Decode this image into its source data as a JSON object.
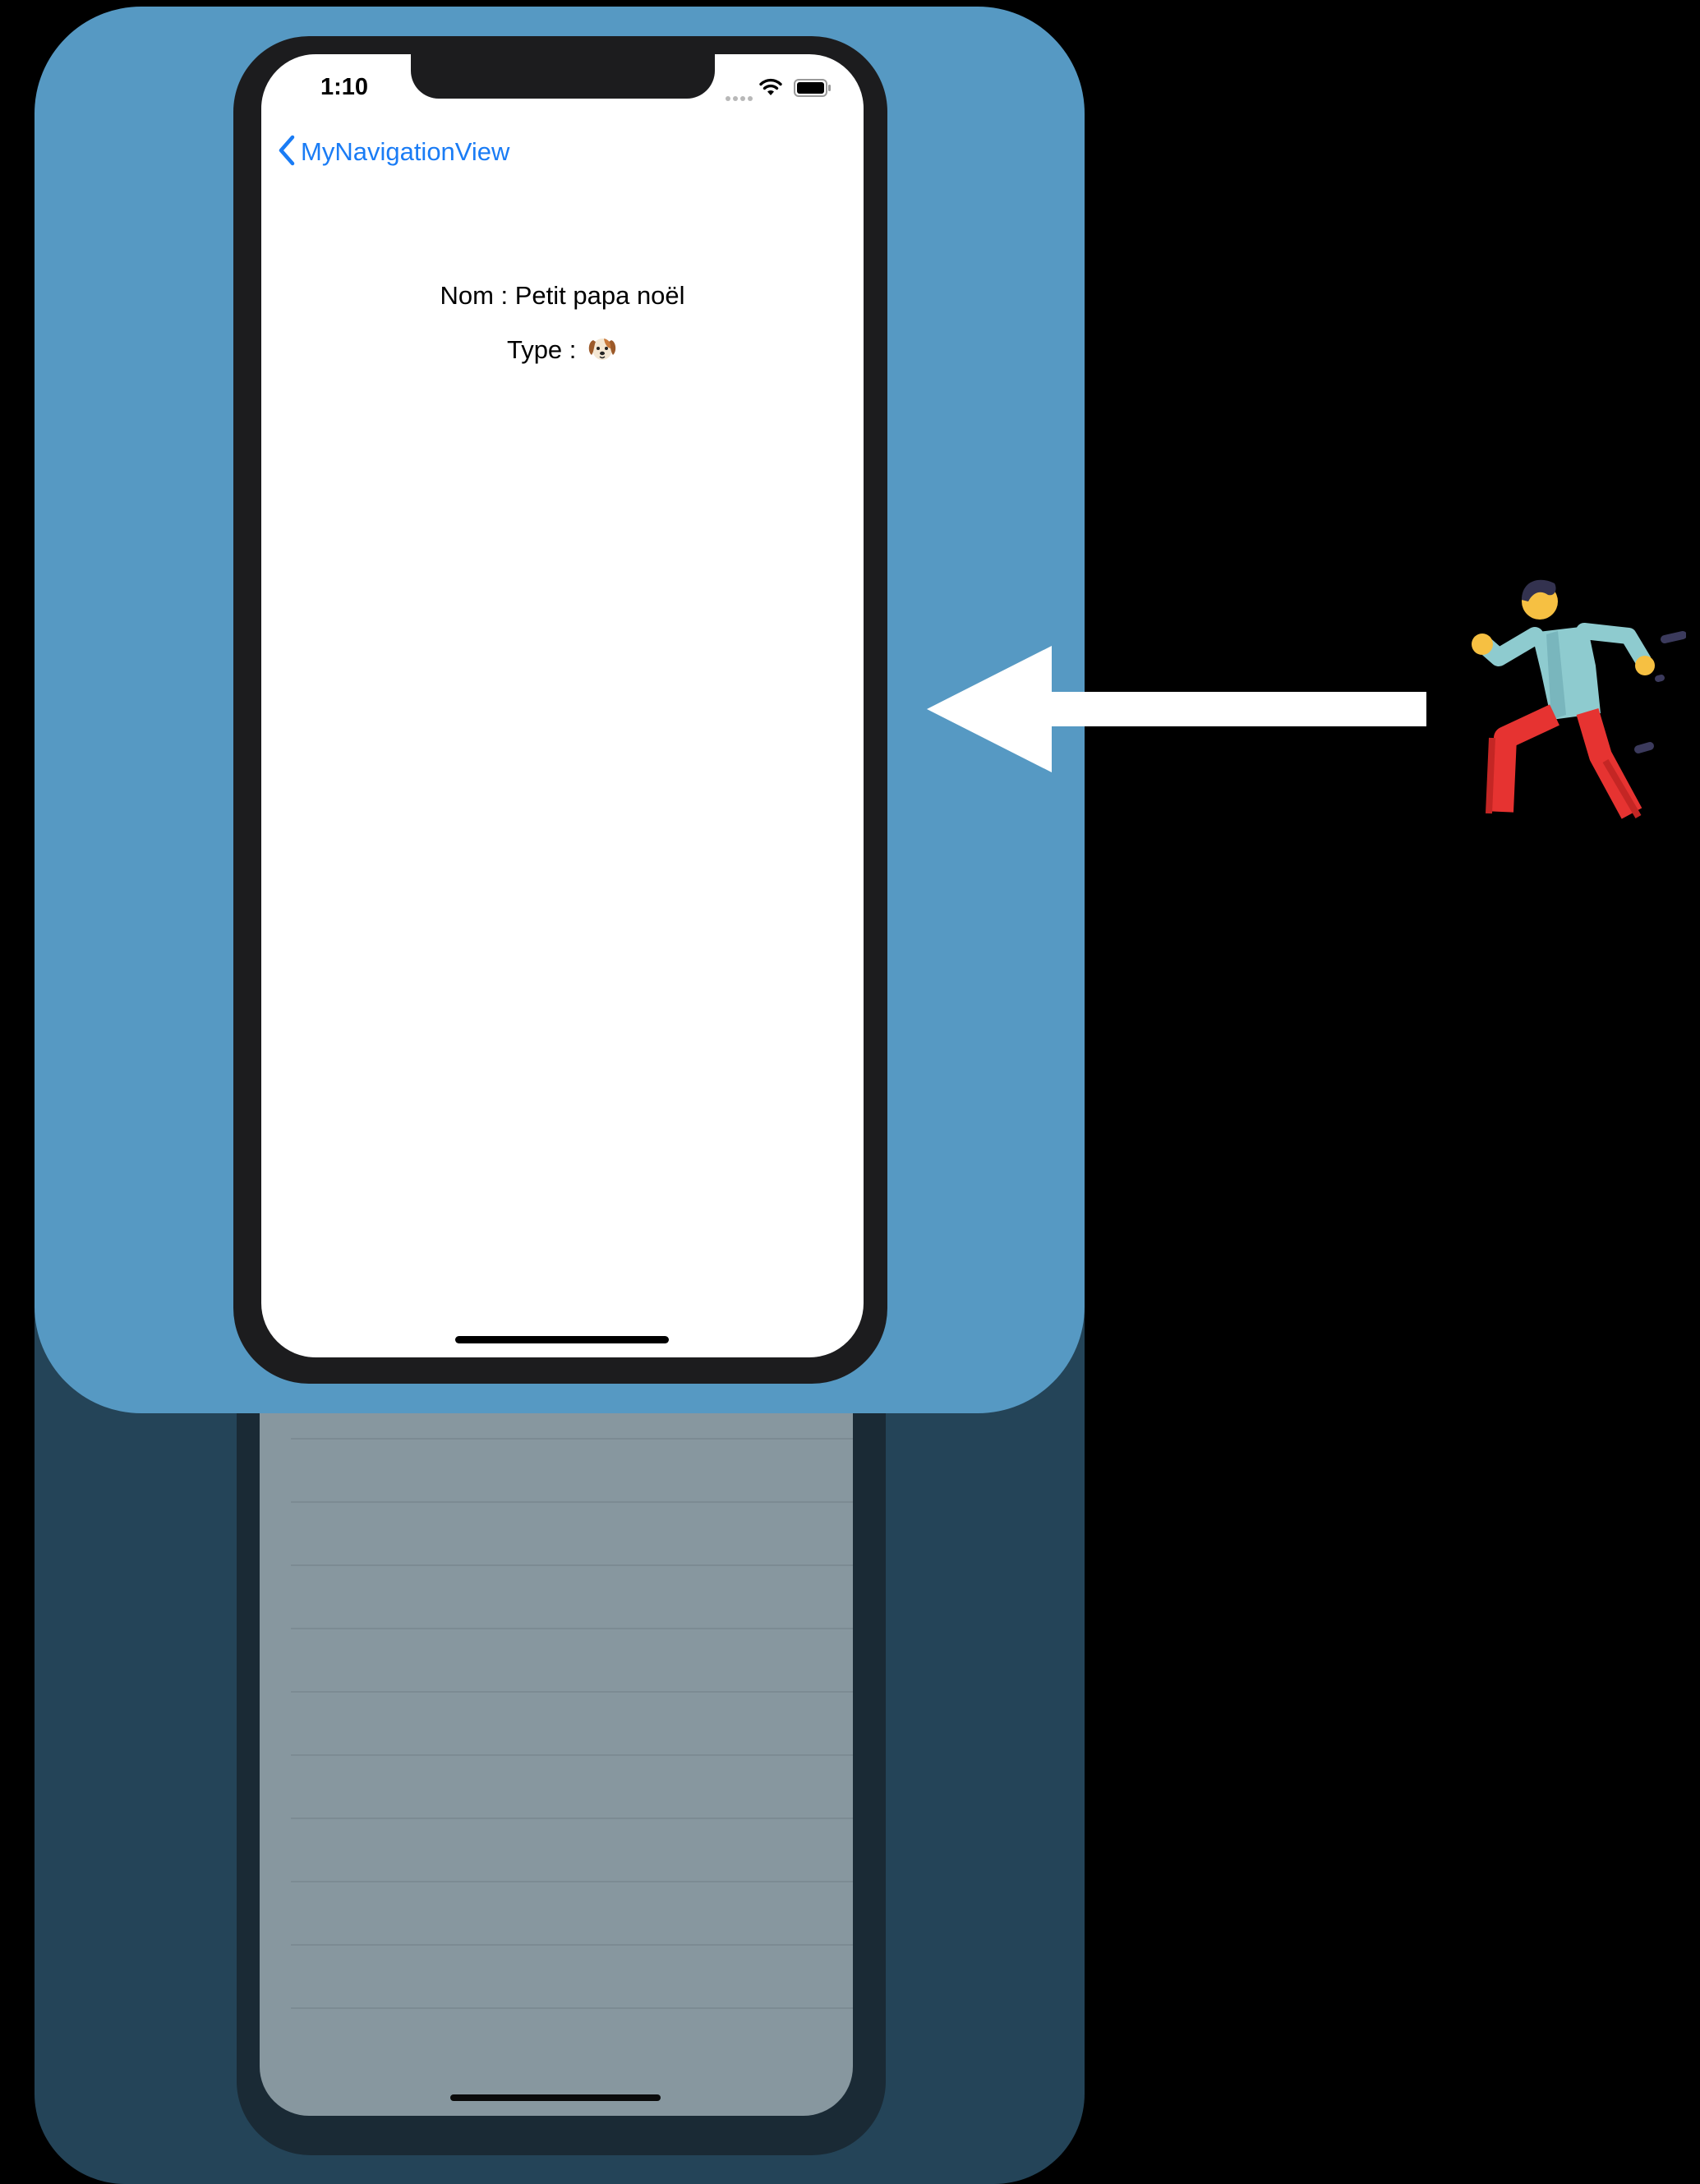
{
  "status_bar": {
    "time": "1:10"
  },
  "nav": {
    "back_label": "MyNavigationView"
  },
  "detail": {
    "name_text": "Nom : Petit papa noël",
    "type_prefix": "Type : ",
    "type_emoji_icon": "dog-face-icon"
  },
  "colors": {
    "front_card": "#5699c3",
    "back_card": "#244458",
    "accent_link": "#1a7cf5",
    "background": "#000000"
  },
  "icons": {
    "back_chevron": "chevron-left-icon",
    "wifi": "wifi-icon",
    "battery": "battery-icon",
    "arrow": "arrow-left-icon",
    "runner": "running-person-icon"
  }
}
